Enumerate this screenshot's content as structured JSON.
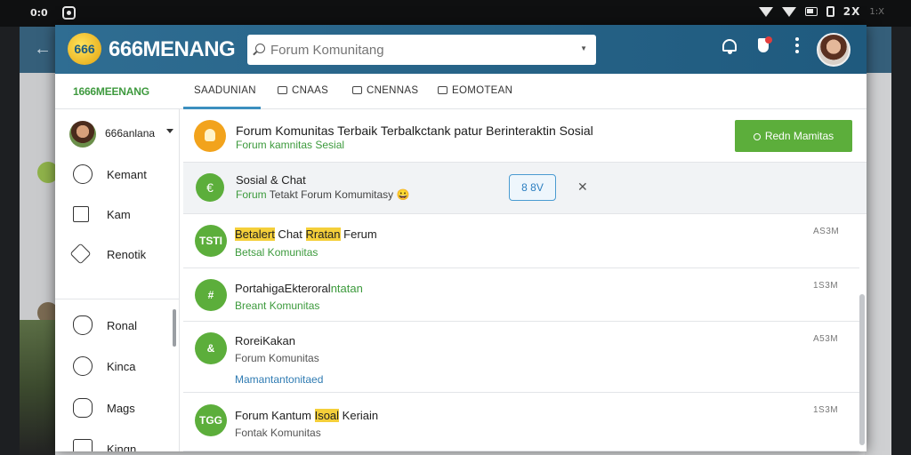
{
  "status_bar": {
    "left_text": "0:0",
    "right_text": "2X",
    "right_dim": "1:X"
  },
  "app": {
    "logo_badge": "666",
    "brand_name": "666MENANG",
    "sub_brand": "1666MEENANG",
    "search_placeholder": "Forum Komunitang"
  },
  "tabs": [
    {
      "label": "SAADUNIAN"
    },
    {
      "label": "CNAAS"
    },
    {
      "label": "CNENNAS"
    },
    {
      "label": "EOMOTEAN"
    }
  ],
  "sidebar": {
    "username": "666anlana",
    "items": [
      {
        "label": "Kemant",
        "icon": "users-icon"
      },
      {
        "label": "Kam",
        "icon": "inbox-icon"
      },
      {
        "label": "Renotik",
        "icon": "tag-icon"
      },
      {
        "label": "Ronal",
        "icon": "heart-icon"
      },
      {
        "label": "Kinca",
        "icon": "clock-icon"
      },
      {
        "label": "Mags",
        "icon": "pin-icon"
      },
      {
        "label": "Kingn",
        "icon": "folder-icon"
      }
    ]
  },
  "hero": {
    "title": "Forum Komunitas Terbaik Terbalkctank patur Berinteraktin Sosial",
    "subtitle": "Forum kamnitas Sesial",
    "button": "Redn Mamitas"
  },
  "featured": {
    "title": "Sosial & Chat",
    "subtitle_green": "Forum",
    "subtitle_rest": "Tetakt Forum Komumitasy",
    "emoji": "😀",
    "button": "8 8V",
    "close": "✕"
  },
  "posts": [
    {
      "title_hl": "Betalert",
      "title_mid": " Chat ",
      "title_hl2": "Rratan",
      "title_end": " Ferum",
      "subtitle": "Betsal Komunitas",
      "time": "AS3M",
      "icon_text": "TSTI"
    },
    {
      "title_plain": "Portahiga",
      "title_mid": "Ekteroral",
      "title_green": "ntatan",
      "subtitle": "Breant Komunitas",
      "time": "1S3M",
      "icon_text": "#"
    },
    {
      "title_plain": "RoreiKakan",
      "subtitle": "Forum Komunitas",
      "extra": "Mamantantonitaed",
      "time": "A53M",
      "icon_text": "&"
    },
    {
      "title_plain": "Forum Kantum ",
      "title_hl": "Isoal",
      "title_end": " Keriain",
      "subtitle": "Fontak Komunitas",
      "time": "1S3M",
      "icon_text": "TGG"
    }
  ],
  "colors": {
    "brand_blue": "#2f6d92",
    "accent_green": "#5cae3b",
    "hero_orange": "#f2a31c",
    "highlight_yellow": "#f4cf3a"
  }
}
